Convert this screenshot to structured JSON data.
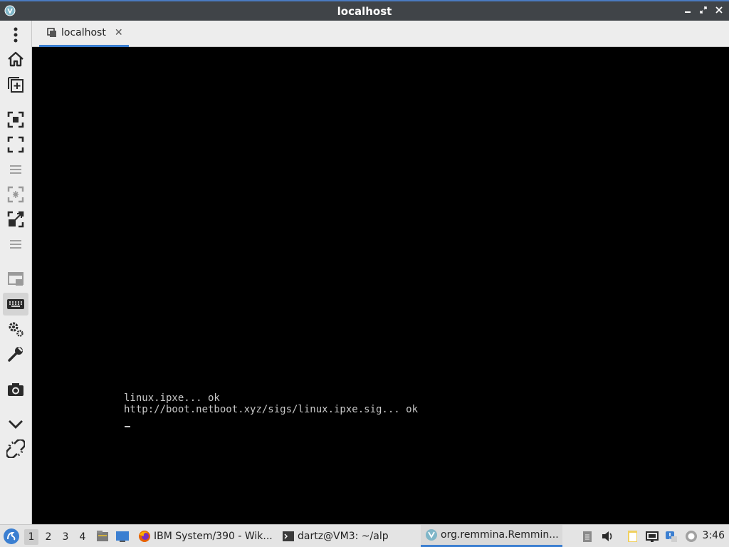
{
  "window": {
    "title": "localhost",
    "controls": [
      "minimize",
      "restore",
      "close"
    ]
  },
  "toolbar": {
    "items": [
      {
        "name": "menu",
        "icon": "kebab-menu-icon"
      },
      {
        "name": "home",
        "icon": "home-icon"
      },
      {
        "name": "new-connection",
        "icon": "add-tab-icon"
      },
      {
        "name": "fit-window",
        "icon": "fit-window-icon"
      },
      {
        "name": "fullscreen",
        "icon": "fullscreen-icon"
      },
      {
        "name": "fullscreen-menu",
        "icon": "hamburger-icon"
      },
      {
        "name": "auto-fit",
        "icon": "auto-fit-icon"
      },
      {
        "name": "scale",
        "icon": "scale-icon"
      },
      {
        "name": "scale-menu",
        "icon": "hamburger-icon"
      },
      {
        "name": "multi-monitor",
        "icon": "multi-monitor-icon"
      },
      {
        "name": "grab-keyboard",
        "icon": "keyboard-icon"
      },
      {
        "name": "preferences",
        "icon": "gears-icon"
      },
      {
        "name": "tools",
        "icon": "wrench-icon"
      },
      {
        "name": "screenshot",
        "icon": "camera-icon"
      },
      {
        "name": "minimize",
        "icon": "chevron-down-icon"
      },
      {
        "name": "disconnect",
        "icon": "disconnect-icon"
      }
    ]
  },
  "tab": {
    "label": "localhost",
    "close": "✕"
  },
  "console": {
    "lines": [
      "linux.ipxe... ok",
      "http://boot.netboot.xyz/sigs/linux.ipxe.sig... ok"
    ]
  },
  "taskbar": {
    "workspaces": [
      "1",
      "2",
      "3",
      "4"
    ],
    "active_workspace": "1",
    "tasks": [
      {
        "label": "IBM System/390 - Wik...",
        "icon": "firefox-icon"
      },
      {
        "label": "dartz@VM3: ~/alp",
        "icon": "terminal-icon"
      },
      {
        "label": "org.remmina.Remmin...",
        "icon": "remmina-icon"
      }
    ],
    "clock": "3:46"
  },
  "colors": {
    "accent": "#3b7fd1",
    "titlebar": "#404448",
    "remote_bg": "#000000"
  }
}
